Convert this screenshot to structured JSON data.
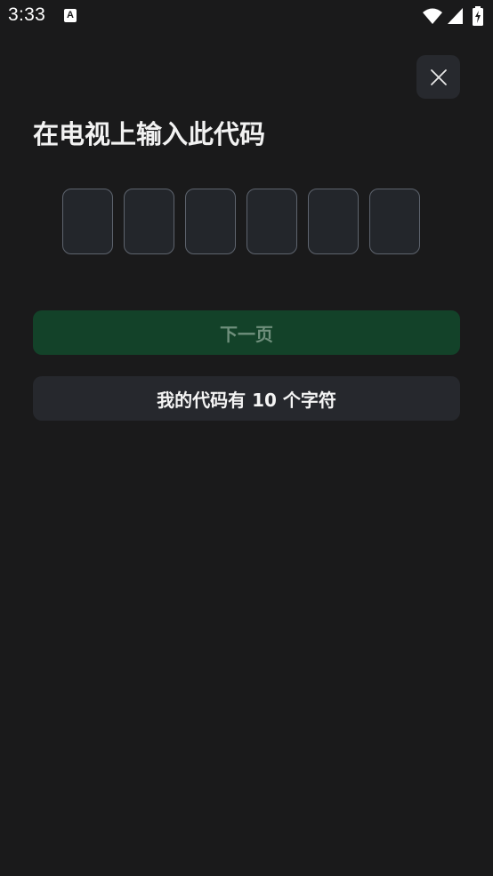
{
  "status_bar": {
    "time": "3:33",
    "notification_icon": "A"
  },
  "dialog": {
    "title": "在电视上输入此代码",
    "code_slots": [
      "",
      "",
      "",
      "",
      "",
      ""
    ],
    "next_button_label": "下一页",
    "ten_char_button_label": "我的代码有 10 个字符"
  },
  "colors": {
    "background": "#1a1a1b",
    "next_button_bg": "#134229",
    "next_button_text": "#6f8f7c",
    "secondary_button_bg": "#26282d",
    "code_box_border": "#5e646e"
  },
  "icons": {
    "close": "close-icon",
    "wifi": "wifi-icon",
    "signal": "signal-icon",
    "battery": "battery-charging-icon"
  }
}
